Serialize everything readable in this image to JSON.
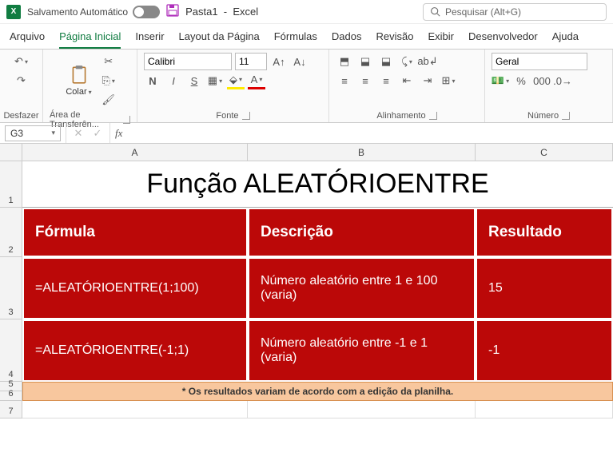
{
  "titlebar": {
    "autosave_label": "Salvamento Automático",
    "doc_name": "Pasta1",
    "app_name": "Excel",
    "search_placeholder": "Pesquisar (Alt+G)"
  },
  "tabs": {
    "arquivo": "Arquivo",
    "inicio": "Página Inicial",
    "inserir": "Inserir",
    "layout": "Layout da Página",
    "formulas": "Fórmulas",
    "dados": "Dados",
    "revisao": "Revisão",
    "exibir": "Exibir",
    "desenvolvedor": "Desenvolvedor",
    "ajuda": "Ajuda"
  },
  "ribbon": {
    "desfazer": "Desfazer",
    "clipboard_label": "Área de Transferên...",
    "colar": "Colar",
    "fonte": "Fonte",
    "font_name": "Calibri",
    "font_size": "11",
    "alinhamento": "Alinhamento",
    "numero": "Número",
    "numero_format": "Geral"
  },
  "formula_bar": {
    "cell_ref": "G3",
    "formula": ""
  },
  "columns": {
    "a": "A",
    "b": "B",
    "c": "C"
  },
  "rows": {
    "r1": "1",
    "r2": "2",
    "r3": "3",
    "r4": "4",
    "r5": "5",
    "r6": "6",
    "r7": "7"
  },
  "sheet": {
    "title": "Função ALEATÓRIOENTRE",
    "headers": {
      "formula": "Fórmula",
      "descricao": "Descrição",
      "resultado": "Resultado"
    },
    "row1": {
      "formula": "=ALEATÓRIOENTRE(1;100)",
      "desc": "Número aleatório entre 1 e 100 (varia)",
      "result": "15"
    },
    "row2": {
      "formula": "=ALEATÓRIOENTRE(-1;1)",
      "desc": "Número aleatório entre -1 e 1 (varia)",
      "result": "-1"
    },
    "note": "* Os resultados variam de acordo com a edição da planilha."
  }
}
